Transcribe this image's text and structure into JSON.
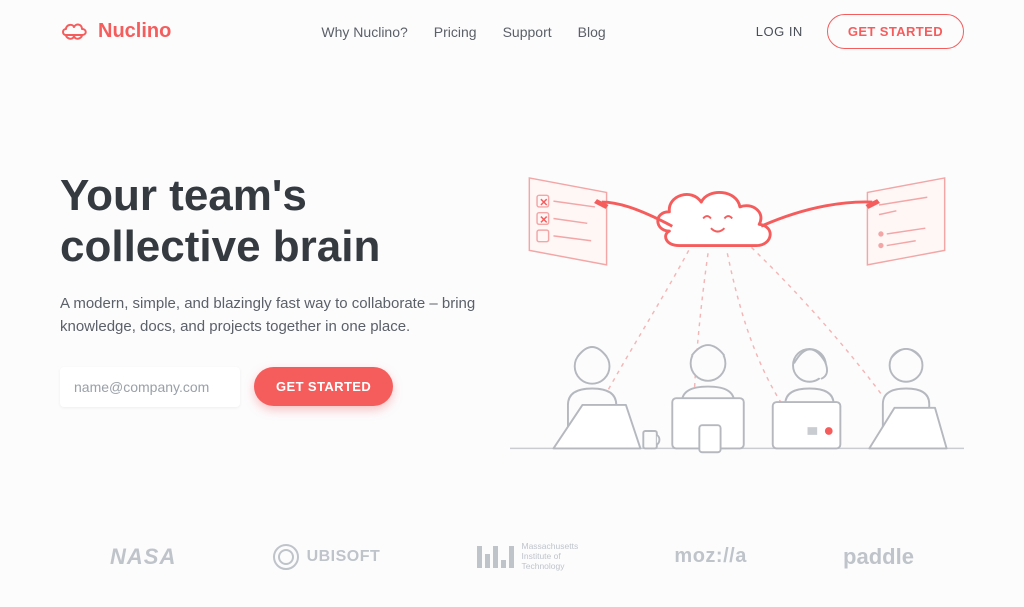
{
  "brand": {
    "name": "Nuclino"
  },
  "nav": {
    "items": [
      "Why Nuclino?",
      "Pricing",
      "Support",
      "Blog"
    ],
    "login": "LOG IN",
    "cta": "GET STARTED"
  },
  "hero": {
    "title_line1": "Your team's",
    "title_line2": "collective brain",
    "subtitle": "A modern, simple, and blazingly fast way to collaborate – bring knowledge, docs, and projects together in one place.",
    "email_placeholder": "name@company.com",
    "cta": "GET STARTED"
  },
  "clients": {
    "nasa": "NASA",
    "ubisoft": "UBISOFT",
    "mit_sub": "Massachusetts\nInstitute of\nTechnology",
    "mozilla": "moz://a",
    "paddle": "paddle"
  }
}
